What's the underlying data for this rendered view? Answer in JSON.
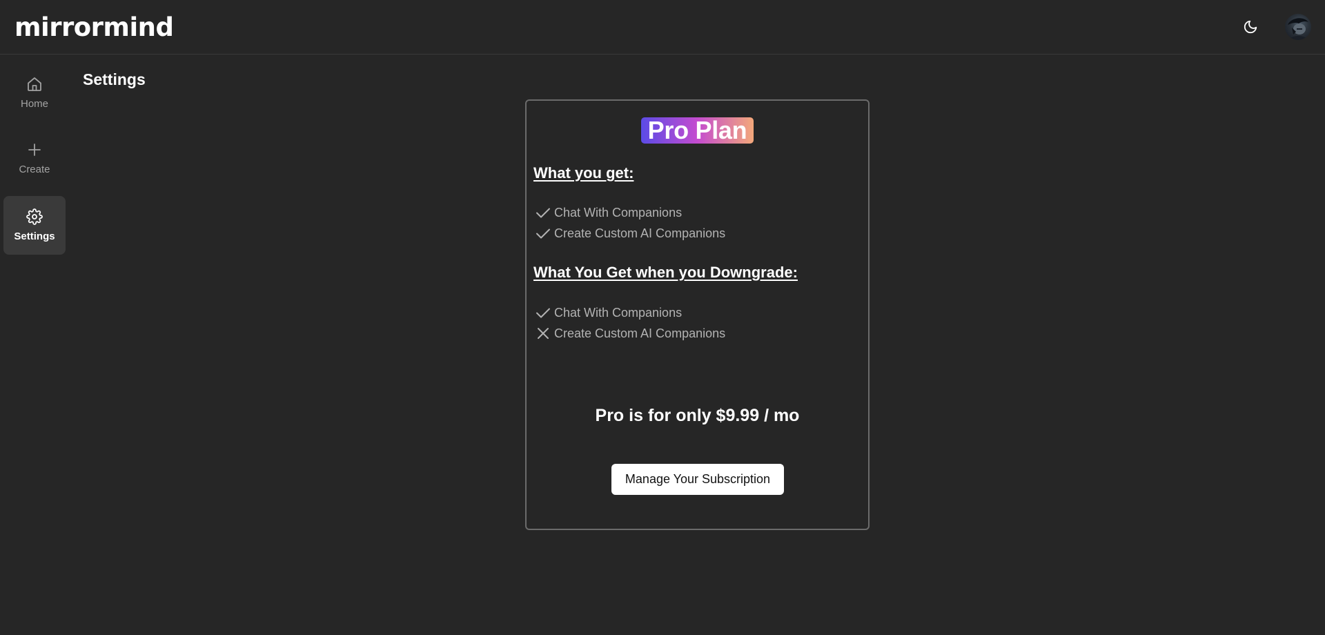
{
  "app": {
    "logo": "mirrormind"
  },
  "header": {
    "theme_toggle_icon": "moon-icon",
    "avatar_icon": "user-avatar"
  },
  "sidebar": {
    "items": [
      {
        "label": "Home",
        "icon": "home-icon",
        "active": false
      },
      {
        "label": "Create",
        "icon": "plus-icon",
        "active": false
      },
      {
        "label": "Settings",
        "icon": "gear-icon",
        "active": true
      }
    ]
  },
  "page": {
    "title": "Settings"
  },
  "plan": {
    "badge": "Pro Plan",
    "badge_colors": [
      "#5b4be6",
      "#c44ccf",
      "#f3a87a"
    ],
    "get_heading": "What you get:",
    "get_features": [
      {
        "text": "Chat With Companions",
        "icon": "check-icon"
      },
      {
        "text": "Create Custom AI Companions",
        "icon": "check-icon"
      }
    ],
    "downgrade_heading": "What You Get when you Downgrade:",
    "downgrade_features": [
      {
        "text": "Chat With Companions",
        "icon": "check-icon"
      },
      {
        "text": "Create Custom AI Companions",
        "icon": "x-icon"
      }
    ],
    "price_text": "Pro is for only $9.99 / mo",
    "manage_button": "Manage Your Subscription"
  }
}
